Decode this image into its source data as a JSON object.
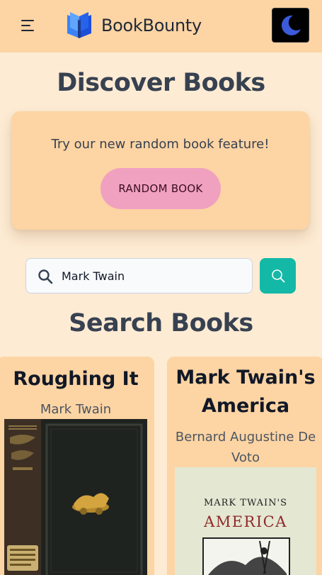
{
  "header": {
    "brand": "BookBounty",
    "icons": {
      "menu": "hamburger-menu-icon",
      "logo": "open-book-logo-icon",
      "theme": "moon-icon"
    }
  },
  "discover": {
    "title": "Discover Books",
    "promo_text": "Try our new random book feature!",
    "random_button": "RANDOM BOOK"
  },
  "search": {
    "value": "Mark Twain",
    "icons": {
      "input": "search-icon",
      "button": "search-icon"
    }
  },
  "results": {
    "title": "Search Books",
    "books": [
      {
        "title": "Roughing It",
        "author": "Mark Twain"
      },
      {
        "title": "Mark Twain's America",
        "author": "Bernard Augustine De Voto"
      }
    ]
  },
  "colors": {
    "background": "#fdebd3",
    "header": "#fdd4a3",
    "card": "#fdd4a3",
    "random_button": "#f0a1bf",
    "search_button": "#14b8a6",
    "logo_blue": "#2563eb",
    "moon": "#3b5bdb"
  }
}
